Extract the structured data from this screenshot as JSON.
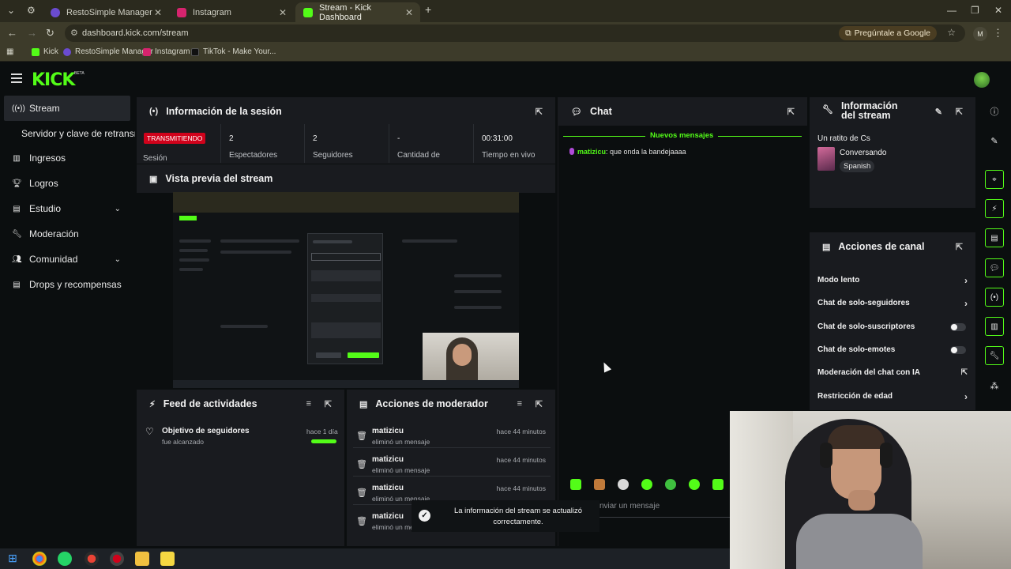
{
  "browser": {
    "tabs": [
      {
        "title": "RestoSimple Manager",
        "color": "#6a4bd0"
      },
      {
        "title": "Instagram",
        "color": "#d6246e"
      },
      {
        "title": "Stream - Kick Dashboard",
        "color": "#53fc18"
      }
    ],
    "url": "dashboard.kick.com/stream",
    "ask_google": "Pregúntale a Google",
    "profile_initial": "M",
    "bookmarks": [
      "Kick",
      "RestoSimple Manager",
      "Instagram",
      "TikTok - Make Your..."
    ]
  },
  "app": {
    "logo": "KICK",
    "beta": "BETA",
    "accent": "#53fc18"
  },
  "sidebar": {
    "items": [
      {
        "label": "Stream",
        "icon": "broadcast-icon"
      },
      {
        "label": "Servidor y clave de retransm",
        "icon": ""
      },
      {
        "label": "Ingresos",
        "icon": "chart-icon"
      },
      {
        "label": "Logros",
        "icon": "trophy-icon"
      },
      {
        "label": "Estudio",
        "icon": "grid-icon"
      },
      {
        "label": "Moderación",
        "icon": "wrench-icon"
      },
      {
        "label": "Comunidad",
        "icon": "people-icon"
      },
      {
        "label": "Drops y recompensas",
        "icon": "gift-icon"
      }
    ]
  },
  "session": {
    "title": "Información de la sesión",
    "status": "TRANSMITIENDO",
    "status_label": "Sesión",
    "stats": [
      {
        "value": "2",
        "label": "Espectadores"
      },
      {
        "value": "2",
        "label": "Seguidores"
      },
      {
        "value": "-",
        "label": "Cantidad de"
      },
      {
        "value": "00:31:00",
        "label": "Tiempo en vivo"
      }
    ]
  },
  "preview": {
    "title": "Vista previa del stream"
  },
  "feed": {
    "title": "Feed de actividades",
    "items": [
      {
        "title": "Objetivo de seguidores",
        "sub": "fue alcanzado",
        "time": "hace 1 día",
        "progress": 1.0
      }
    ]
  },
  "mod_actions": {
    "title": "Acciones de moderador",
    "rows": [
      {
        "user": "matizicu",
        "desc": "eliminó un mensaje",
        "time": "hace 44 minutos"
      },
      {
        "user": "matizicu",
        "desc": "eliminó un mensaje",
        "time": "hace 44 minutos"
      },
      {
        "user": "matizicu",
        "desc": "eliminó un mensaje",
        "time": "hace 44 minutos"
      },
      {
        "user": "matizicu",
        "desc": "eliminó un mensaje",
        "time": ""
      }
    ]
  },
  "chat": {
    "title": "Chat",
    "new_messages": "Nuevos mensajes",
    "messages": [
      {
        "user": "matizicu",
        "text": ": que onda la bandejaaaa"
      }
    ],
    "input_placeholder": "nviar un mensaje"
  },
  "stream_info": {
    "title": "Información del stream",
    "stream_title": "Un ratito de Cs",
    "category": "Conversando",
    "language": "Spanish"
  },
  "channel_actions": {
    "title": "Acciones de canal",
    "rows": [
      {
        "label": "Modo lento",
        "kind": "arrow"
      },
      {
        "label": "Chat de solo-seguidores",
        "kind": "arrow"
      },
      {
        "label": "Chat de solo-suscriptores",
        "kind": "toggle"
      },
      {
        "label": "Chat de solo-emotes",
        "kind": "toggle"
      },
      {
        "label": "Moderación del chat con IA",
        "kind": "external"
      },
      {
        "label": "Restricción de edad",
        "kind": "arrow"
      }
    ]
  },
  "toast": {
    "text": "La información del stream se actualizó correctamente."
  }
}
